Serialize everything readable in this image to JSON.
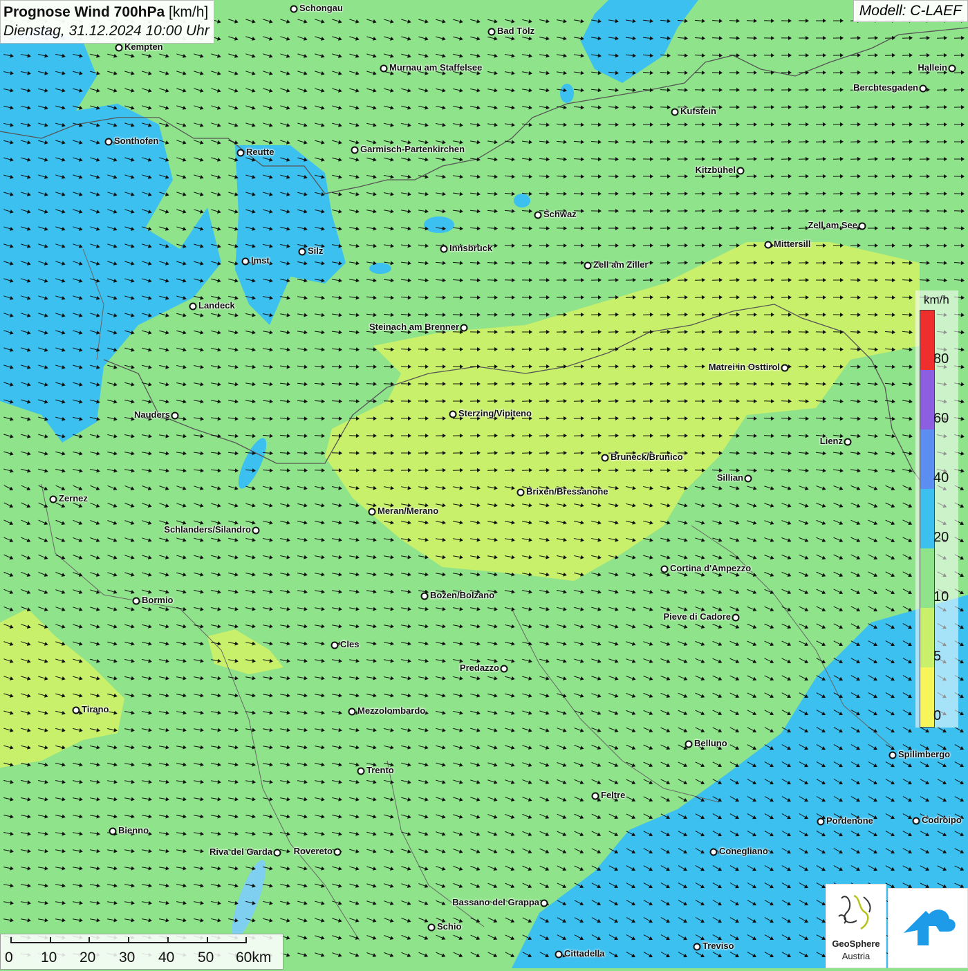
{
  "header": {
    "title_main": "Prognose Wind 700hPa",
    "title_unit": "[km/h]",
    "date_line": "Dienstag, 31.12.2024 10:00 Uhr",
    "model": "Modell: C-LAEF"
  },
  "legend": {
    "unit": "km/h",
    "ticks": [
      "80",
      "60",
      "40",
      "20",
      "10",
      "5",
      "0"
    ],
    "colors": [
      "#ef2e2e",
      "#8b5fe0",
      "#5b8ef0",
      "#3cc0f0",
      "#8fe38a",
      "#c9f06a",
      "#f6f65a"
    ]
  },
  "scale": {
    "labels": [
      "0",
      "10",
      "20",
      "30",
      "40",
      "50",
      "60km"
    ]
  },
  "logo": {
    "name_line1": "GeoSphere",
    "name_line2": "Austria"
  },
  "wind_colors": {
    "blue_zone": "#3cc0f0",
    "green_zone": "#8fe38a",
    "yellow_zone": "#c9f06a"
  },
  "cities": [
    {
      "name": "Schongau"
    },
    {
      "name": "Bad Tölz"
    },
    {
      "name": "Kempten"
    },
    {
      "name": "Murnau am Staffelsee"
    },
    {
      "name": "Hallein"
    },
    {
      "name": "Berchtesgaden"
    },
    {
      "name": "Kufstein"
    },
    {
      "name": "Sonthofen"
    },
    {
      "name": "Reutte"
    },
    {
      "name": "Garmisch-Partenkirchen"
    },
    {
      "name": "Kitzbühel"
    },
    {
      "name": "Schwaz"
    },
    {
      "name": "Zell am See"
    },
    {
      "name": "Mittersill"
    },
    {
      "name": "Innsbruck"
    },
    {
      "name": "Silz"
    },
    {
      "name": "Imst"
    },
    {
      "name": "Zell am Ziller"
    },
    {
      "name": "Landeck"
    },
    {
      "name": "Steinach am Brenner"
    },
    {
      "name": "Matrei in Osttirol"
    },
    {
      "name": "Nauders"
    },
    {
      "name": "Sterzing/Vipiteno"
    },
    {
      "name": "Lienz"
    },
    {
      "name": "Bruneck/Brunico"
    },
    {
      "name": "Sillian"
    },
    {
      "name": "Brixen/Bressanone"
    },
    {
      "name": "Zernez"
    },
    {
      "name": "Meran/Merano"
    },
    {
      "name": "Schlanders/Silandro"
    },
    {
      "name": "Cortina d'Ampezzo"
    },
    {
      "name": "Bozen/Bolzano"
    },
    {
      "name": "Bormio"
    },
    {
      "name": "Pieve di Cadore"
    },
    {
      "name": "Cles"
    },
    {
      "name": "Predazzo"
    },
    {
      "name": "Tirano"
    },
    {
      "name": "Mezzolombardo"
    },
    {
      "name": "Belluno"
    },
    {
      "name": "Spilimbergo"
    },
    {
      "name": "Trento"
    },
    {
      "name": "Feltre"
    },
    {
      "name": "Pordenone"
    },
    {
      "name": "Codroipo"
    },
    {
      "name": "Bienno"
    },
    {
      "name": "Riva del Garda"
    },
    {
      "name": "Rovereto"
    },
    {
      "name": "Conegliano"
    },
    {
      "name": "Bassano del Grappa"
    },
    {
      "name": "Schio"
    },
    {
      "name": "Treviso"
    },
    {
      "name": "Cittadella"
    }
  ]
}
